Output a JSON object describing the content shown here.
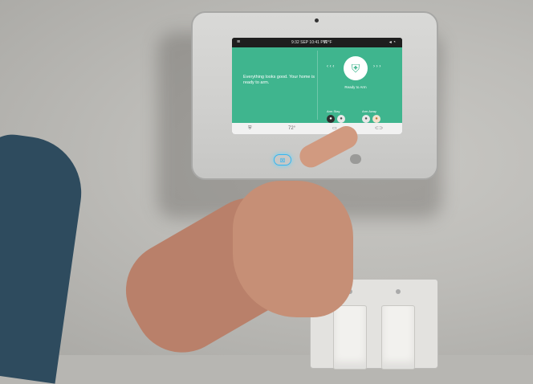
{
  "panel": {
    "statusbar": {
      "time": "9:32 SEP 10:41 PM",
      "temp": "72°F"
    },
    "message": "Everything looks good. Your home is ready to arm.",
    "state": "Ready to Arm",
    "modes": [
      "Arm Stay",
      "Arm Away"
    ],
    "bottom_temp": "72°"
  },
  "icons": [
    "menu-icon",
    "shield-icon",
    "home-button-icon",
    "thermostat-icon",
    "camera-icon",
    "lock-icon"
  ],
  "colors": {
    "screen_accent": "#3fb58e",
    "home_glow": "#37b5ee"
  }
}
